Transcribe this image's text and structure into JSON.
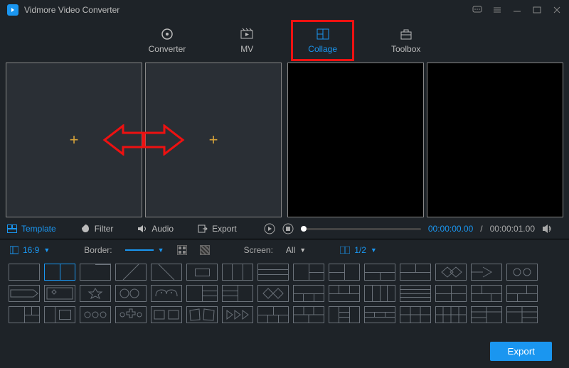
{
  "app": {
    "title": "Vidmore Video Converter"
  },
  "tabs": {
    "converter": "Converter",
    "mv": "MV",
    "collage": "Collage",
    "toolbox": "Toolbox"
  },
  "subtabs": {
    "template": "Template",
    "filter": "Filter",
    "audio": "Audio",
    "export": "Export"
  },
  "controls": {
    "aspect": "16:9",
    "border_label": "Border:",
    "screen_label": "Screen:",
    "screen_value": "All",
    "page": "1/2"
  },
  "player": {
    "current": "00:00:00.00",
    "sep": "/",
    "total": "00:00:01.00"
  },
  "footer": {
    "export": "Export"
  }
}
